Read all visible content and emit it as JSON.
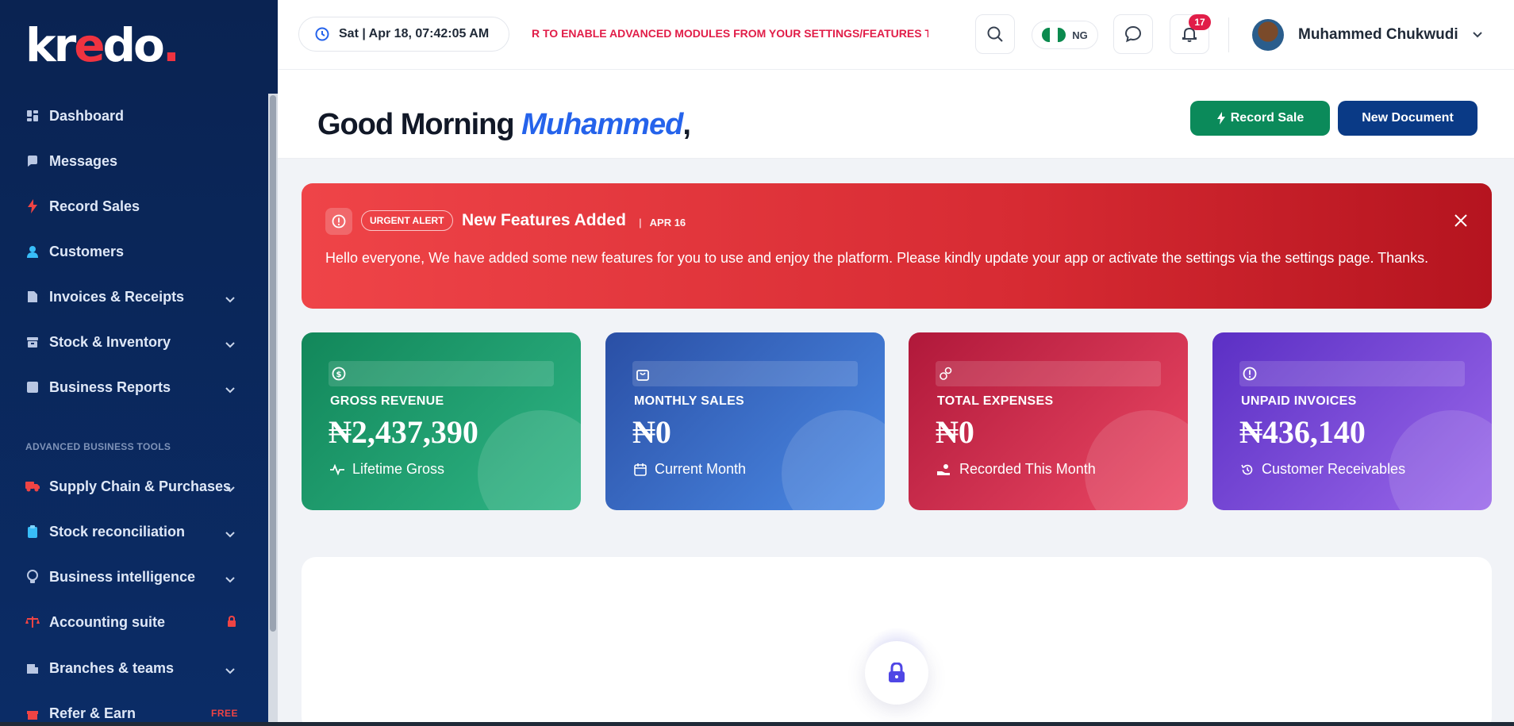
{
  "sidebar": {
    "logo": "kredo",
    "items": [
      {
        "label": "Dashboard",
        "icon": "dashboard-icon"
      },
      {
        "label": "Messages",
        "icon": "chat-icon"
      },
      {
        "label": "Record Sales",
        "icon": "bolt-icon"
      },
      {
        "label": "Customers",
        "icon": "user-icon"
      },
      {
        "label": "Invoices & Receipts",
        "icon": "document-icon"
      },
      {
        "label": "Stock & Inventory",
        "icon": "archive-icon"
      },
      {
        "label": "Business Reports",
        "icon": "report-icon"
      }
    ],
    "section_title": "ADVANCED BUSINESS TOOLS",
    "advanced_items": [
      {
        "label": "Supply Chain & Purchases",
        "icon": "truck-icon"
      },
      {
        "label": "Stock reconciliation",
        "icon": "clipboard-icon"
      },
      {
        "label": "Business intelligence",
        "icon": "lightbulb-icon"
      },
      {
        "label": "Accounting suite",
        "icon": "scale-icon"
      },
      {
        "label": "Branches & teams",
        "icon": "building-icon"
      },
      {
        "label": "Refer & Earn",
        "icon": "gift-icon",
        "tag": "FREE"
      }
    ]
  },
  "topbar": {
    "datetime": "Sat | Apr 18, 07:42:05 AM",
    "ticker": "R TO ENABLE ADVANCED MODULES FROM YOUR SETTINGS/FEATURES T",
    "country": "NG",
    "notifications": "17",
    "user_name": "Muhammed Chukwudi"
  },
  "greeting": {
    "prefix": "Good Morning",
    "name": "Muhammed",
    "suffix": ","
  },
  "actions": {
    "record_sale": "Record Sale",
    "new_document": "New Document"
  },
  "alert": {
    "tag": "URGENT ALERT",
    "title": "New Features Added",
    "separator": "|",
    "date": "APR 16",
    "body": "Hello everyone, We have added some new features for you to use and enjoy the platform. Please kindly update your app or activate the settings via the settings page. Thanks."
  },
  "stats": [
    {
      "label": "GROSS REVENUE",
      "value": "₦2,437,390",
      "sub": "Lifetime Gross",
      "icon": "dollar-icon",
      "sub_icon": "pulse-icon"
    },
    {
      "label": "MONTHLY SALES",
      "value": "₦0",
      "sub": "Current Month",
      "icon": "bag-icon",
      "sub_icon": "calendar-icon"
    },
    {
      "label": "TOTAL EXPENSES",
      "value": "₦0",
      "sub": "Recorded This Month",
      "icon": "coins-icon",
      "sub_icon": "hand-coins-icon"
    },
    {
      "label": "UNPAID INVOICES",
      "value": "₦436,140",
      "sub": "Customer Receivables",
      "icon": "alert-circle-icon",
      "sub_icon": "history-icon"
    }
  ],
  "colors": {
    "sidebar_bg": "#0a2352",
    "accent_red": "#ef3340",
    "green": "#0b8a5a",
    "navy": "#0a3a86",
    "name_blue": "#2563eb"
  }
}
